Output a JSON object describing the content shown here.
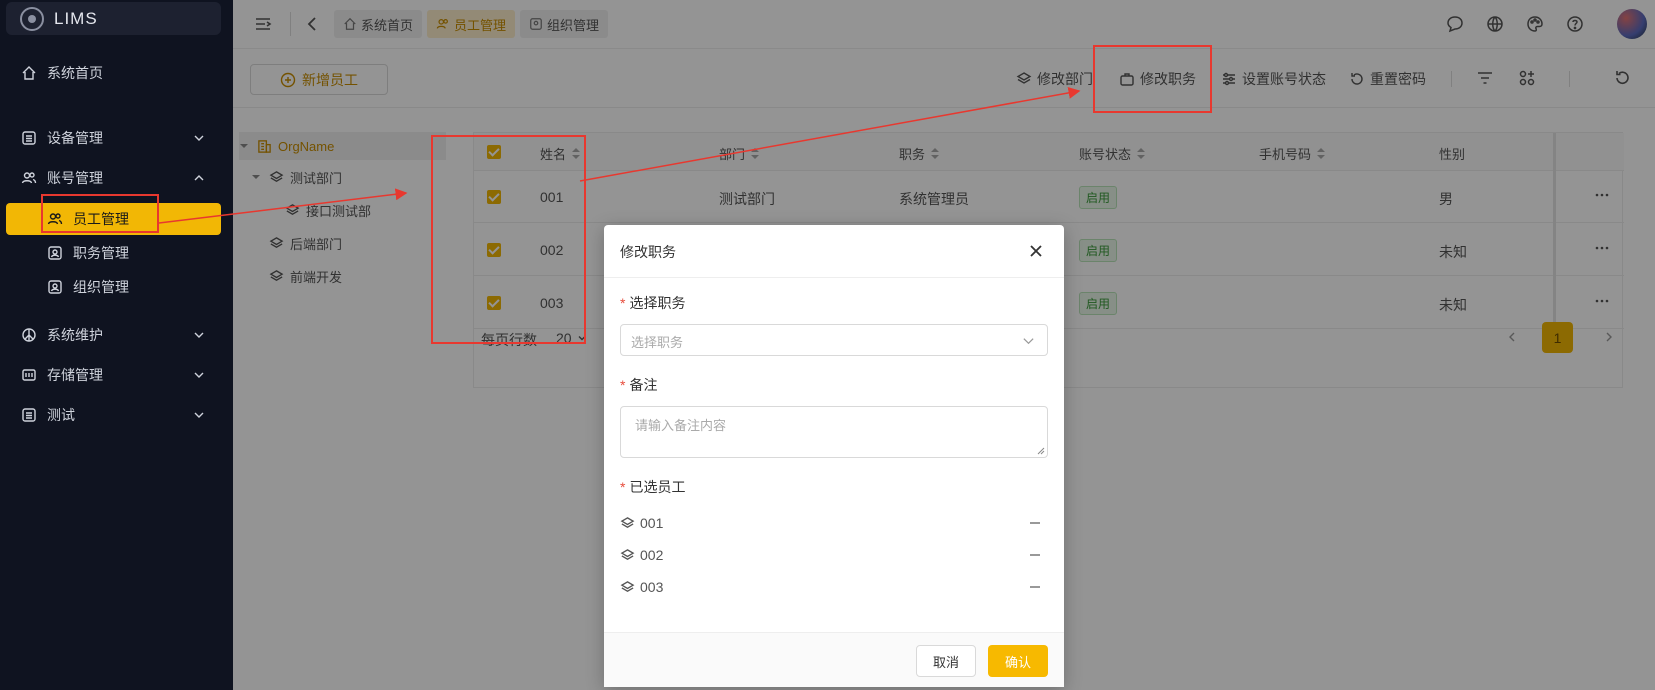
{
  "app": {
    "name": "LIMS"
  },
  "sidebar": {
    "items": [
      {
        "label": "系统首页"
      },
      {
        "label": "设备管理"
      },
      {
        "label": "账号管理"
      },
      {
        "label": "员工管理"
      },
      {
        "label": "职务管理"
      },
      {
        "label": "组织管理"
      },
      {
        "label": "系统维护"
      },
      {
        "label": "存储管理"
      },
      {
        "label": "测试"
      }
    ]
  },
  "tabs": [
    {
      "label": "系统首页"
    },
    {
      "label": "员工管理"
    },
    {
      "label": "组织管理"
    }
  ],
  "toolbar": {
    "add_label": "新增员工",
    "edit_dept_label": "修改部门",
    "edit_position_label": "修改职务",
    "set_status_label": "设置账号状态",
    "reset_password_label": "重置密码"
  },
  "tree": {
    "root": "OrgName",
    "nodes": [
      "测试部门",
      "接口测试部",
      "后端部门",
      "前端开发"
    ]
  },
  "table": {
    "headers": [
      "姓名",
      "部门",
      "职务",
      "账号状态",
      "手机号码",
      "性别"
    ],
    "rows": [
      {
        "name": "001",
        "dept": "测试部门",
        "position": "系统管理员",
        "status": "启用",
        "phone": "",
        "gender": "男"
      },
      {
        "name": "002",
        "dept": "",
        "position": "",
        "status": "启用",
        "phone": "",
        "gender": "未知"
      },
      {
        "name": "003",
        "dept": "",
        "position": "",
        "status": "启用",
        "phone": "",
        "gender": "未知"
      }
    ],
    "page_size_label": "每页行数",
    "page_size": "20",
    "current_page": "1"
  },
  "dialog": {
    "title": "修改职务",
    "position_label": "选择职务",
    "position_placeholder": "选择职务",
    "remark_label": "备注",
    "remark_placeholder": "请输入备注内容",
    "selected_label": "已选员工",
    "selected": [
      "001",
      "002",
      "003"
    ],
    "cancel_label": "取消",
    "ok_label": "确认"
  },
  "colors": {
    "accent": "#f2b705",
    "sidebar_bg": "#0f1320",
    "annotation": "#e8382f"
  }
}
